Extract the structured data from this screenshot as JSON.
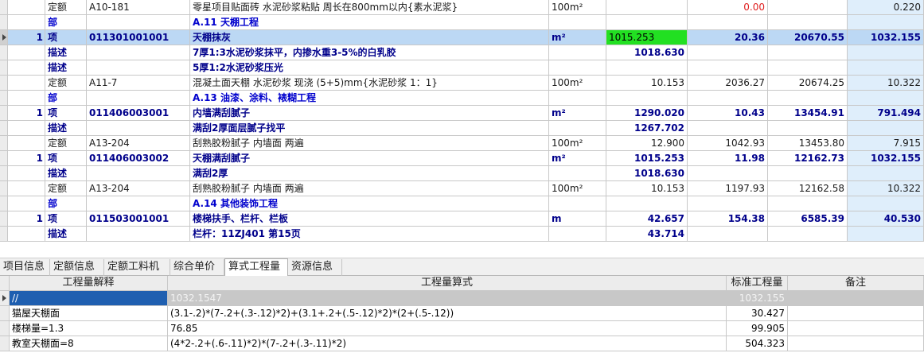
{
  "top_rows": [
    {
      "no": "",
      "type": "定额",
      "code": "A10-181",
      "name": "零星项目贴面砖 水泥砂浆粘贴 周长在800mm以内{素水泥浆}",
      "unit": "100m²",
      "qty": "",
      "price": "0.00",
      "total": "",
      "qty2": "0.220",
      "style": "std"
    },
    {
      "no": "",
      "type": "部",
      "code": "",
      "name": "A.11 天棚工程",
      "unit": "",
      "qty": "",
      "price": "",
      "total": "",
      "qty2": "",
      "style": "section"
    },
    {
      "no": "1",
      "type": "项",
      "code": "011301001001",
      "name": "天棚抹灰",
      "unit": "m²",
      "qty": "1015.253",
      "price": "20.36",
      "total": "20670.55",
      "qty2": "1032.155",
      "style": "bold"
    },
    {
      "no": "",
      "type": "描述",
      "code": "",
      "name": "7厚1:3水泥砂浆抹平，内掺水重3-5%的白乳胶",
      "unit": "",
      "qty": "1018.630",
      "price": "",
      "total": "",
      "qty2": "",
      "style": "bold"
    },
    {
      "no": "",
      "type": "描述",
      "code": "",
      "name": "5厚1:2水泥砂浆压光",
      "unit": "",
      "qty": "",
      "price": "",
      "total": "",
      "qty2": "",
      "style": "bold"
    },
    {
      "no": "",
      "type": "定额",
      "code": "A11-7",
      "name": "混凝土面天棚 水泥砂浆 现浇 (5+5)mm{水泥砂浆 1：1}",
      "unit": "100m²",
      "qty": "10.153",
      "price": "2036.27",
      "total": "20674.25",
      "qty2": "10.322",
      "style": "std"
    },
    {
      "no": "",
      "type": "部",
      "code": "",
      "name": "A.13 油漆、涂料、裱糊工程",
      "unit": "",
      "qty": "",
      "price": "",
      "total": "",
      "qty2": "",
      "style": "section"
    },
    {
      "no": "1",
      "type": "项",
      "code": "011406003001",
      "name": "内墙满刮腻子",
      "unit": "m²",
      "qty": "1290.020",
      "price": "10.43",
      "total": "13454.91",
      "qty2": "791.494",
      "style": "bold"
    },
    {
      "no": "",
      "type": "描述",
      "code": "",
      "name": "满刮2厚面层腻子找平",
      "unit": "",
      "qty": "1267.702",
      "price": "",
      "total": "",
      "qty2": "",
      "style": "bold"
    },
    {
      "no": "",
      "type": "定额",
      "code": "A13-204",
      "name": "刮熟胶粉腻子 内墙面 两遍",
      "unit": "100m²",
      "qty": "12.900",
      "price": "1042.93",
      "total": "13453.80",
      "qty2": "7.915",
      "style": "std"
    },
    {
      "no": "1",
      "type": "项",
      "code": "011406003002",
      "name": "天棚满刮腻子",
      "unit": "m²",
      "qty": "1015.253",
      "price": "11.98",
      "total": "12162.73",
      "qty2": "1032.155",
      "style": "bold"
    },
    {
      "no": "",
      "type": "描述",
      "code": "",
      "name": "满刮2厚",
      "unit": "",
      "qty": "1018.630",
      "price": "",
      "total": "",
      "qty2": "",
      "style": "bold"
    },
    {
      "no": "",
      "type": "定额",
      "code": "A13-204",
      "name": "刮熟胶粉腻子 内墙面 两遍",
      "unit": "100m²",
      "qty": "10.153",
      "price": "1197.93",
      "total": "12162.58",
      "qty2": "10.322",
      "style": "std"
    },
    {
      "no": "",
      "type": "部",
      "code": "",
      "name": "A.14 其他装饰工程",
      "unit": "",
      "qty": "",
      "price": "",
      "total": "",
      "qty2": "",
      "style": "section"
    },
    {
      "no": "1",
      "type": "项",
      "code": "011503001001",
      "name": "楼梯扶手、栏杆、栏板",
      "unit": "m",
      "qty": "42.657",
      "price": "154.38",
      "total": "6585.39",
      "qty2": "40.530",
      "style": "bold"
    },
    {
      "no": "",
      "type": "描述",
      "code": "",
      "name": "栏杆：11ZJ401 第15页",
      "unit": "",
      "qty": "43.714",
      "price": "",
      "total": "",
      "qty2": "",
      "style": "bold"
    }
  ],
  "tabs": [
    "项目信息",
    "定额信息",
    "定额工料机",
    "综合单价",
    "算式工程量",
    "资源信息"
  ],
  "active_tab": 4,
  "bottom_headers": [
    "工程量解释",
    "工程量算式",
    "标准工程量",
    "备注"
  ],
  "bottom_rows": [
    {
      "desc": "//",
      "formula": "1032.1547",
      "std_qty": "1032.155",
      "note": ""
    },
    {
      "desc": "猫屋天棚面",
      "formula": "(3.1-.2)*(7-.2+(.3-.12)*2)+(3.1+.2+(.5-.12)*2)*(2+(.5-.12))",
      "std_qty": "30.427",
      "note": ""
    },
    {
      "desc": "楼梯量=1.3",
      "formula": "76.85",
      "std_qty": "99.905",
      "note": ""
    },
    {
      "desc": "教室天棚面=8",
      "formula": "(4*2-.2+(.6-.11)*2)*(7-.2+(.3-.11)*2)",
      "std_qty": "504.323",
      "note": ""
    }
  ]
}
